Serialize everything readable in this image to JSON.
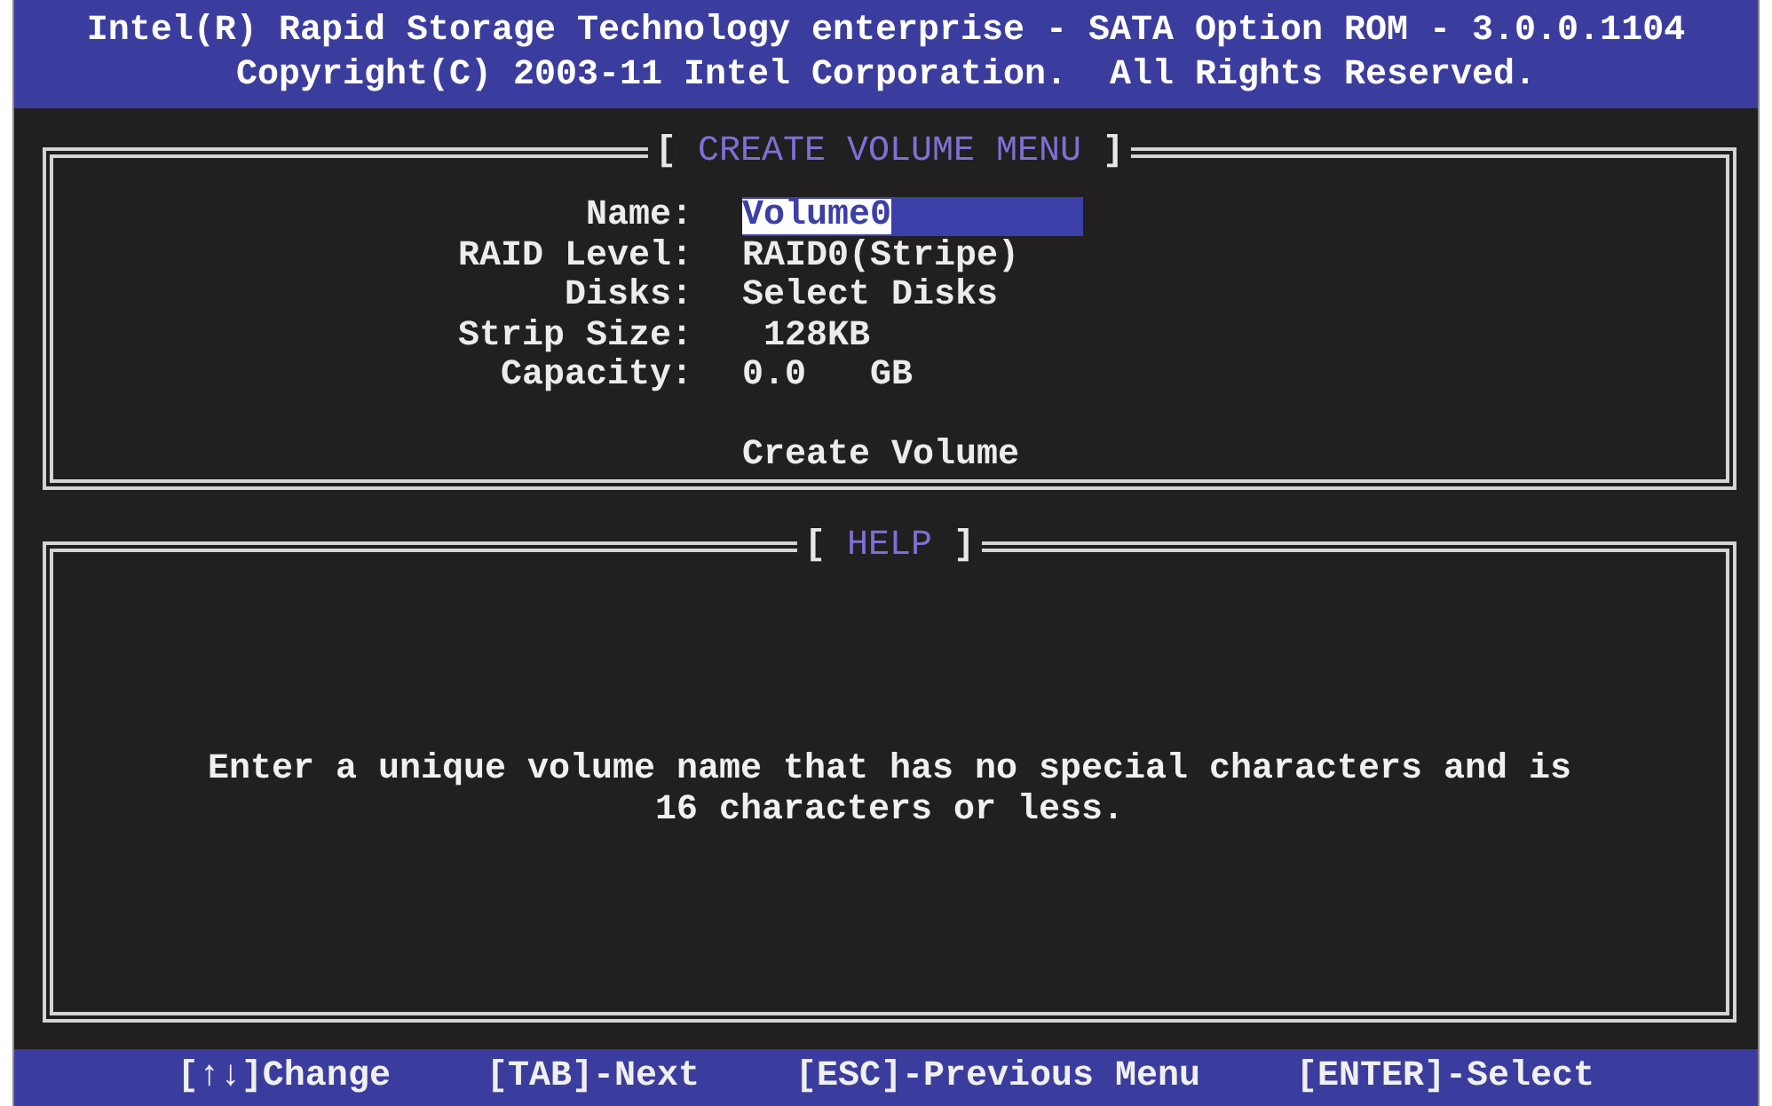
{
  "header": {
    "title": "Intel(R) Rapid Storage Technology enterprise - SATA Option ROM - 3.0.0.1104",
    "copyright": "Copyright(C) 2003-11 Intel Corporation.  All Rights Reserved."
  },
  "create_volume_menu": {
    "bracket_left": "[",
    "title": "CREATE VOLUME MENU",
    "bracket_right": "]",
    "fields": [
      {
        "kind": "input",
        "label": "Name:",
        "value": "Volume0",
        "focused": true
      },
      {
        "kind": "value",
        "label": "RAID Level:",
        "value": "RAID0(Stripe)"
      },
      {
        "kind": "value",
        "label": "Disks:",
        "value": "Select Disks"
      },
      {
        "kind": "value",
        "label": "Strip Size:",
        "value": " 128KB"
      },
      {
        "kind": "value",
        "label": "Capacity:",
        "value": "0.0   GB"
      }
    ],
    "action": "Create Volume"
  },
  "help": {
    "bracket_left": "[",
    "title": "HELP",
    "bracket_right": "]",
    "text": "Enter a unique volume name that has no special characters and is 16 characters or less."
  },
  "key_hints": [
    "[↑↓]Change",
    "[TAB]-Next",
    "[ESC]-Previous Menu",
    "[ENTER]-Select"
  ]
}
